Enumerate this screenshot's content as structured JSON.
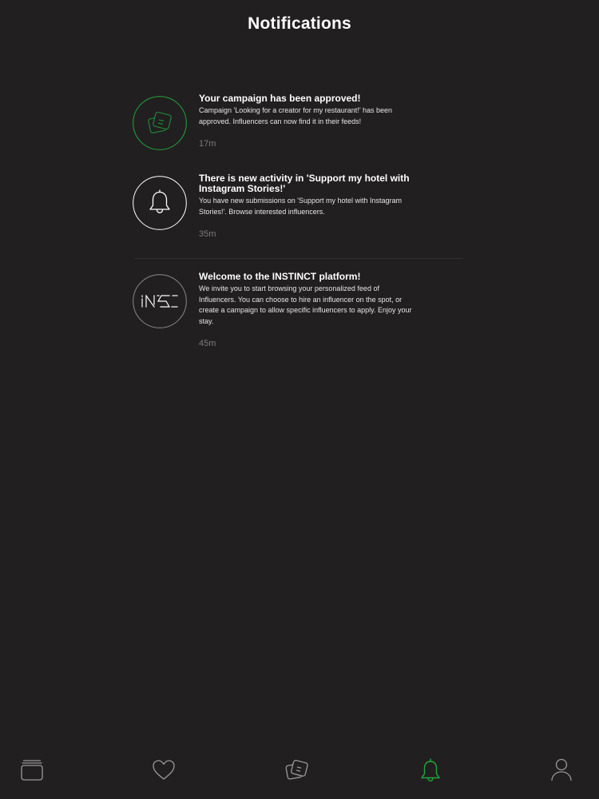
{
  "header": {
    "title": "Notifications"
  },
  "notifications": [
    {
      "title": "Your campaign has been approved!",
      "text": "Campaign 'Looking for a creator for my restaurant!'  has been approved. Influencers can now find it in their feeds!",
      "time": "17m",
      "icon": "campaign-icon",
      "accent": "#1fa83f"
    },
    {
      "title": "There is new activity in 'Support my hotel with Instagram Stories!'",
      "text": "You have new submissions on 'Support my hotel with Instagram Stories!'. Browse interested influencers.",
      "time": "35m",
      "icon": "bell-icon",
      "accent": "#ffffff"
    },
    {
      "title": "Welcome to the INSTINCT platform!",
      "text": "We invite you to start browsing your personalized feed of Influencers. You can choose to hire an influencer on the spot, or create a campaign to allow specific influencers to apply. Enjoy your stay.",
      "time": "45m",
      "icon": "ins-logo-icon",
      "accent": "#8a8a8a"
    }
  ],
  "tabbar": {
    "items": [
      {
        "name": "feed",
        "icon": "cards-icon",
        "active": false
      },
      {
        "name": "favorites",
        "icon": "heart-icon",
        "active": false
      },
      {
        "name": "campaigns",
        "icon": "campaign-icon",
        "active": false
      },
      {
        "name": "notifications",
        "icon": "bell-icon",
        "active": true
      },
      {
        "name": "profile",
        "icon": "user-icon",
        "active": false
      }
    ],
    "active_color": "#1fa83f",
    "inactive_color": "#9a9a9a"
  },
  "colors": {
    "background": "#221f20",
    "time": "#7b7b7b"
  }
}
